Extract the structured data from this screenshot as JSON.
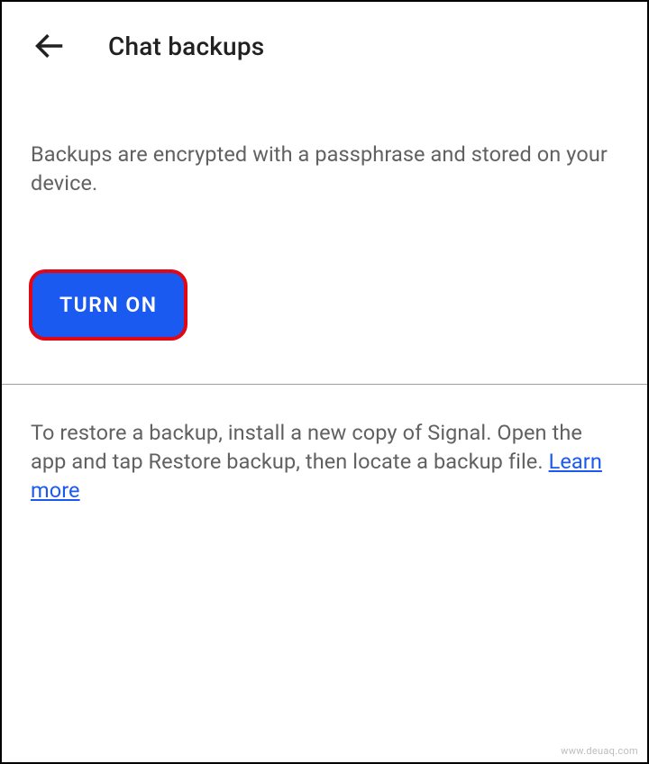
{
  "header": {
    "title": "Chat backups"
  },
  "body": {
    "description": "Backups are encrypted with a passphrase and stored on your device.",
    "turn_on_label": "TURN ON",
    "restore_text_prefix": "To restore a backup, install a new copy of Signal. Open the app and tap Restore backup, then locate a backup file. ",
    "learn_more_label": "Learn more"
  },
  "footer": {
    "watermark": "www.deuaq.com"
  }
}
